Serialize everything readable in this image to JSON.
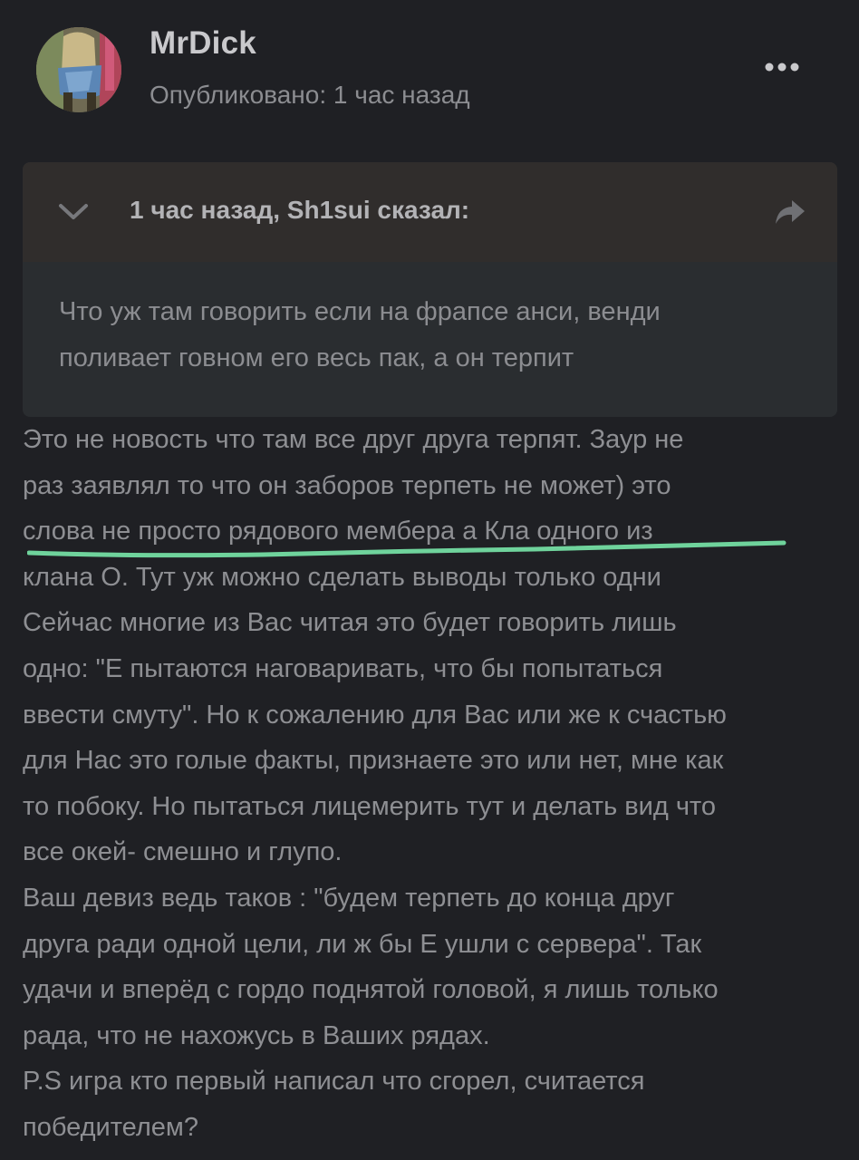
{
  "post": {
    "author": "MrDick",
    "published": "Опубликовано: 1 час назад"
  },
  "icons": {
    "more": "more-horizontal-icon",
    "toggle": "chevron-down-icon",
    "share": "share-arrow-icon"
  },
  "quote": {
    "citation": "1 час назад, Sh1sui сказал:",
    "lines": [
      "Что уж там говорить если на фрапсе анси, венди",
      "поливает говном его весь пак, а он терпит"
    ]
  },
  "content": {
    "lines": [
      "Это не новость что там все друг друга терпят. Заур не",
      "раз заявлял то что он заборов терпеть не может) это",
      "слова не просто рядового мембера а Кла одного из",
      "клана О. Тут уж можно сделать выводы только одни",
      "Сейчас многие из Вас читая это будет говорить лишь",
      "одно: \"Е пытаются наговаривать, что бы попытаться",
      "ввести смуту\". Но к сожалению для Вас или же к счастью",
      "для Нас это голые факты, признаете это или нет, мне как",
      "то побоку. Но пытаться лицемерить тут и делать вид что",
      "все окей- смешно и глупо.",
      "Ваш девиз ведь таков : \"будем терпеть до конца друг",
      "друга ради одной цели, ли ж бы Е ушли с сервера\". Так",
      "удачи и вперёд с гордо поднятой головой, я лишь только",
      "рада, что не нахожусь в Ваших рядах.",
      "P.S игра кто первый написал что сгорел, считается",
      "победителем?"
    ]
  },
  "colors": {
    "background": "#1f2024",
    "quote_header": "#302d2c",
    "quote_body": "#2a2d30",
    "text": "#8e8f93",
    "author": "#c9c9cc",
    "highlight": "#6fd39c"
  }
}
